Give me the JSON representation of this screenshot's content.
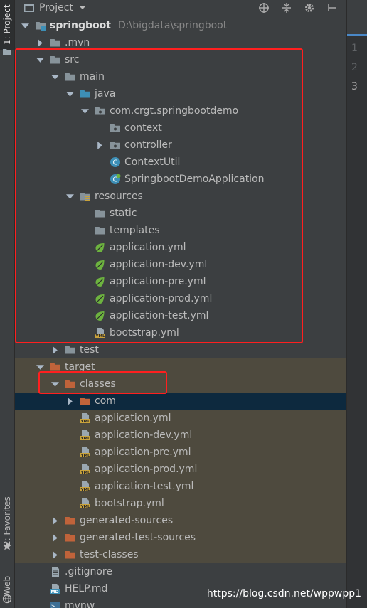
{
  "left_bar": {
    "project_tab": "1: Project",
    "favorites_tab": "2: Favorites",
    "web_tab": "Web"
  },
  "header": {
    "title": "Project",
    "dropdown_icon": "chevron-down-icon",
    "actions": [
      "crosshair-icon",
      "collapse-icon",
      "gear-icon",
      "hide-icon"
    ]
  },
  "editor": {
    "line_numbers": [
      "1",
      "2",
      "3"
    ]
  },
  "tree": [
    {
      "label": "springboot",
      "sub": "D:\\bigdata\\springboot",
      "indent": 0,
      "arrow": "down",
      "icon": "module-folder-icon",
      "bold": true
    },
    {
      "label": ".mvn",
      "indent": 1,
      "arrow": "right",
      "icon": "folder-icon"
    },
    {
      "label": "src",
      "indent": 1,
      "arrow": "down",
      "icon": "folder-icon"
    },
    {
      "label": "main",
      "indent": 2,
      "arrow": "down",
      "icon": "folder-icon"
    },
    {
      "label": "java",
      "indent": 3,
      "arrow": "down",
      "icon": "source-folder-icon"
    },
    {
      "label": "com.crgt.springbootdemo",
      "indent": 4,
      "arrow": "down",
      "icon": "package-icon"
    },
    {
      "label": "context",
      "indent": 5,
      "arrow": "none",
      "icon": "package-icon"
    },
    {
      "label": "controller",
      "indent": 5,
      "arrow": "right",
      "icon": "package-icon"
    },
    {
      "label": "ContextUtil",
      "indent": 5,
      "arrow": "none",
      "icon": "class-icon"
    },
    {
      "label": "SpringbootDemoApplication",
      "indent": 5,
      "arrow": "none",
      "icon": "spring-boot-class-icon"
    },
    {
      "label": "resources",
      "indent": 3,
      "arrow": "down",
      "icon": "resources-folder-icon"
    },
    {
      "label": "static",
      "indent": 4,
      "arrow": "none",
      "icon": "folder-icon"
    },
    {
      "label": "templates",
      "indent": 4,
      "arrow": "none",
      "icon": "folder-icon"
    },
    {
      "label": "application.yml",
      "indent": 4,
      "arrow": "none",
      "icon": "spring-yml-icon"
    },
    {
      "label": "application-dev.yml",
      "indent": 4,
      "arrow": "none",
      "icon": "spring-yml-icon"
    },
    {
      "label": "application-pre.yml",
      "indent": 4,
      "arrow": "none",
      "icon": "spring-yml-icon"
    },
    {
      "label": "application-prod.yml",
      "indent": 4,
      "arrow": "none",
      "icon": "spring-yml-icon"
    },
    {
      "label": "application-test.yml",
      "indent": 4,
      "arrow": "none",
      "icon": "spring-yml-icon"
    },
    {
      "label": "bootstrap.yml",
      "indent": 4,
      "arrow": "none",
      "icon": "yml-file-icon"
    },
    {
      "label": "test",
      "indent": 2,
      "arrow": "right",
      "icon": "folder-icon"
    },
    {
      "label": "target",
      "indent": 1,
      "arrow": "down",
      "icon": "excluded-folder-icon",
      "excluded": true
    },
    {
      "label": "classes",
      "indent": 2,
      "arrow": "down",
      "icon": "excluded-folder-icon",
      "excluded": true
    },
    {
      "label": "com",
      "indent": 3,
      "arrow": "right",
      "icon": "excluded-folder-icon",
      "selected": true
    },
    {
      "label": "application.yml",
      "indent": 3,
      "arrow": "none",
      "icon": "yml-file-icon",
      "excluded": true
    },
    {
      "label": "application-dev.yml",
      "indent": 3,
      "arrow": "none",
      "icon": "yml-file-icon",
      "excluded": true
    },
    {
      "label": "application-pre.yml",
      "indent": 3,
      "arrow": "none",
      "icon": "yml-file-icon",
      "excluded": true
    },
    {
      "label": "application-prod.yml",
      "indent": 3,
      "arrow": "none",
      "icon": "yml-file-icon",
      "excluded": true
    },
    {
      "label": "application-test.yml",
      "indent": 3,
      "arrow": "none",
      "icon": "yml-file-icon",
      "excluded": true
    },
    {
      "label": "bootstrap.yml",
      "indent": 3,
      "arrow": "none",
      "icon": "yml-file-icon",
      "excluded": true
    },
    {
      "label": "generated-sources",
      "indent": 2,
      "arrow": "right",
      "icon": "excluded-folder-icon",
      "excluded": true
    },
    {
      "label": "generated-test-sources",
      "indent": 2,
      "arrow": "right",
      "icon": "excluded-folder-icon",
      "excluded": true
    },
    {
      "label": "test-classes",
      "indent": 2,
      "arrow": "right",
      "icon": "excluded-folder-icon",
      "excluded": true
    },
    {
      "label": ".gitignore",
      "indent": 1,
      "arrow": "none",
      "icon": "text-file-icon"
    },
    {
      "label": "HELP.md",
      "indent": 1,
      "arrow": "none",
      "icon": "markdown-file-icon"
    },
    {
      "label": "mvnw",
      "indent": 1,
      "arrow": "none",
      "icon": "shell-file-icon"
    }
  ],
  "watermark": "https://blog.csdn.net/wppwpp1",
  "colors": {
    "highlight_box": "#ff1f1f",
    "excluded_bg": "#4e4a3e",
    "selected_bg": "#0d293e",
    "folder": "#87939a",
    "source_folder": "#3d8fb6",
    "excluded_folder": "#c0633a",
    "spring": "#6db33f"
  }
}
